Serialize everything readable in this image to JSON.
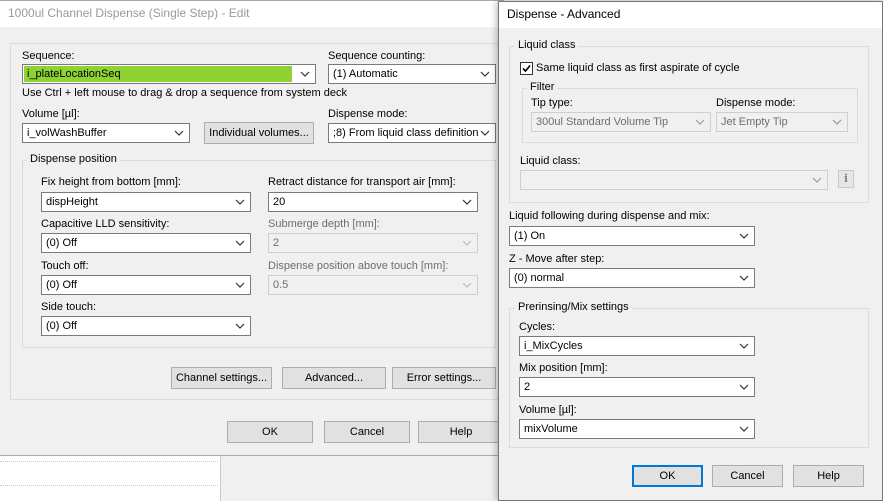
{
  "main_dialog": {
    "title": "1000ul Channel Dispense (Single Step) - Edit",
    "sequence_label": "Sequence:",
    "sequence_value": "i_plateLocationSeq",
    "sequence_counting_label": "Sequence counting:",
    "sequence_counting_value": "(1) Automatic",
    "hint": "Use Ctrl + left mouse to drag & drop a sequence from system deck",
    "volume_label": "Volume [µl]:",
    "volume_value": "i_volWashBuffer",
    "individual_volumes_button": "Individual volumes...",
    "dispense_mode_label": "Dispense mode:",
    "dispense_mode_value": ";8) From liquid class definition",
    "dispense_position_group": "Dispense position",
    "fix_height_label": "Fix height from bottom [mm]:",
    "fix_height_value": "dispHeight",
    "retract_label": "Retract distance for transport air [mm]:",
    "retract_value": "20",
    "capacitive_label": "Capacitive LLD sensitivity:",
    "capacitive_value": "(0) Off",
    "submerge_label": "Submerge depth [mm]:",
    "submerge_value": "2",
    "touch_off_label": "Touch off:",
    "touch_off_value": "(0) Off",
    "dispense_above_touch_label": "Dispense position above touch [mm]:",
    "dispense_above_touch_value": "0.5",
    "side_touch_label": "Side touch:",
    "side_touch_value": "(0) Off",
    "channel_settings_button": "Channel settings...",
    "advanced_button": "Advanced...",
    "error_settings_button": "Error settings...",
    "ok_button": "OK",
    "cancel_button": "Cancel",
    "help_button": "Help"
  },
  "advanced_dialog": {
    "title": "Dispense - Advanced",
    "liquid_class_group": "Liquid class",
    "same_liquid_class_checkbox": "Same liquid class as first aspirate of cycle",
    "same_liquid_class_checked": true,
    "filter_group": "Filter",
    "tip_type_label": "Tip type:",
    "tip_type_value": "300ul Standard Volume Tip",
    "dispense_mode_label": "Dispense mode:",
    "dispense_mode_value": "Jet Empty Tip",
    "liquid_class_label": "Liquid class:",
    "liquid_class_value": "",
    "info_icon": "info-icon",
    "liquid_following_label": "Liquid following during dispense and mix:",
    "liquid_following_value": "(1) On",
    "z_move_label": "Z - Move after step:",
    "z_move_value": "(0) normal",
    "prerinsing_group": "Prerinsing/Mix settings",
    "cycles_label": "Cycles:",
    "cycles_value": "i_MixCycles",
    "mix_position_label": "Mix position [mm]:",
    "mix_position_value": "2",
    "volume_label": "Volume [µl]:",
    "volume_value": "mixVolume",
    "ok_button": "OK",
    "cancel_button": "Cancel",
    "help_button": "Help"
  },
  "colors": {
    "highlight": "#8fd234",
    "default_button_border": "#0078d7",
    "dialog_bg": "#f0f0f0"
  }
}
